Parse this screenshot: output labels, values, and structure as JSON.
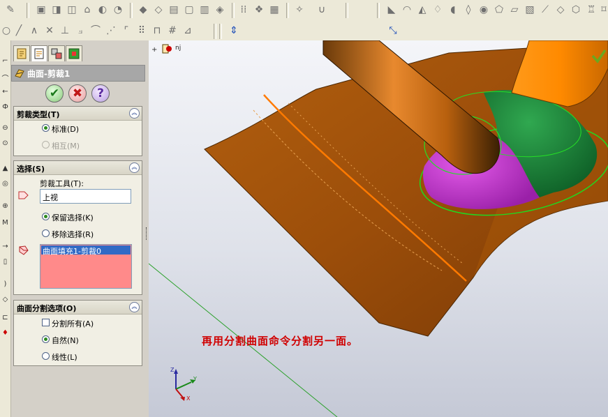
{
  "property_manager": {
    "title": "曲面-剪裁1",
    "trim_type": {
      "header": "剪裁类型(T)",
      "standard_label": "标准(D)",
      "mutual_label": "相互(M)"
    },
    "selections": {
      "header": "选择(S)",
      "trim_tool_label": "剪裁工具(T):",
      "trim_tool_value": "上视",
      "keep_label": "保留选择(K)",
      "remove_label": "移除选择(R)",
      "list_item": "曲面填充1-剪裁0"
    },
    "split_options": {
      "header": "曲面分割选项(O)",
      "split_all_label": "分割所有(A)",
      "natural_label": "自然(N)",
      "linear_label": "线性(L)"
    }
  },
  "viewport": {
    "annotation": "再用分割曲面命令分割另一面。",
    "feature_tag": "nj",
    "triad": {
      "x": "X",
      "y": "Y",
      "z": "Z"
    }
  },
  "colors": {
    "surface": "#a0520c",
    "highlight_edge": "#ff7a00",
    "tool_orange": "#ff8c00",
    "magenta_face": "#c03ccc",
    "green_face": "#18803a",
    "annotation_text": "#d00000"
  },
  "icons": {
    "ok": "check-icon",
    "cancel": "x-icon",
    "help": "question-icon"
  }
}
